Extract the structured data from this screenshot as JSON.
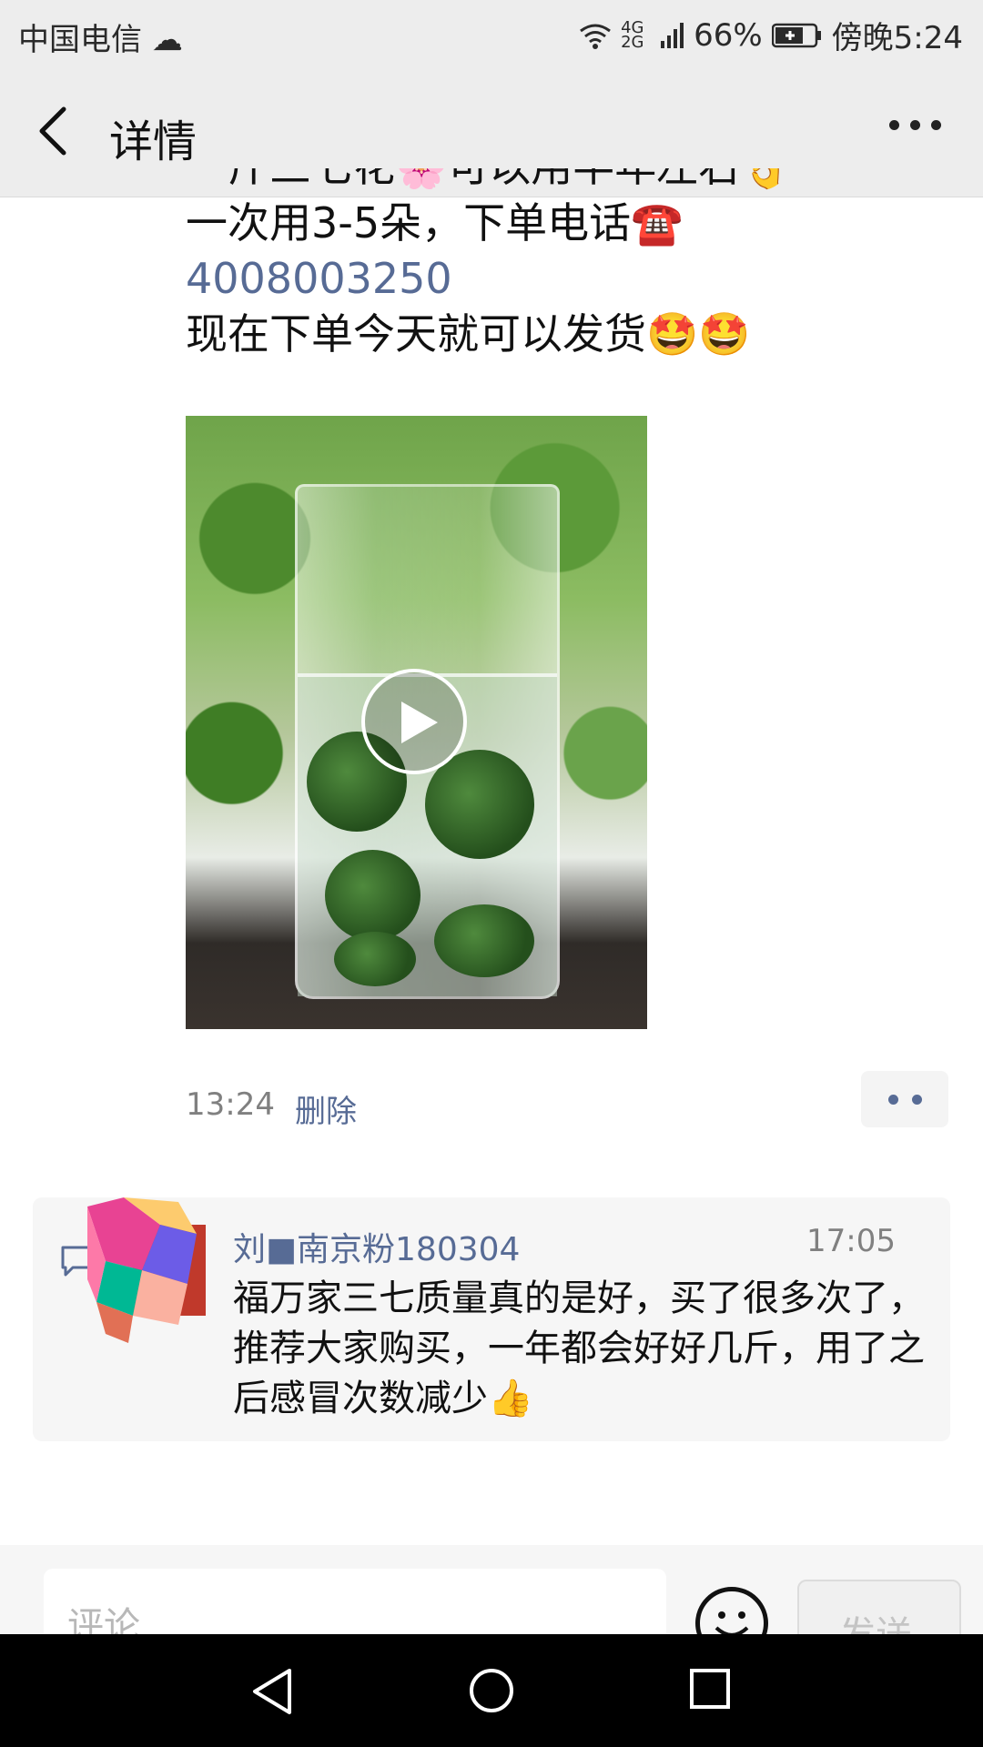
{
  "status_bar": {
    "carrier": "中国电信",
    "network": "4G 2G",
    "battery": "66%",
    "time": "傍晚5:24"
  },
  "header": {
    "title": "详情"
  },
  "post": {
    "clipped_line": "一斤三七花🌸可以用半年左右👌",
    "lines": [
      "一次用3-5朵，下单电话☎️"
    ],
    "phone": "4008003250",
    "line_after_phone": "现在下单今天就可以发货🤩🤩",
    "time": "13:24",
    "delete_label": "删除"
  },
  "comment": {
    "author": "刘■南京粉180304",
    "time": "17:05",
    "text": "福万家三七质量真的是好，买了很多次了，推荐大家购买，一年都会好好几斤，用了之后感冒次数减少👍"
  },
  "input_bar": {
    "placeholder": "评论",
    "send_label": "发送"
  },
  "colors": {
    "link": "#576b95",
    "header_bg": "#ededed"
  }
}
